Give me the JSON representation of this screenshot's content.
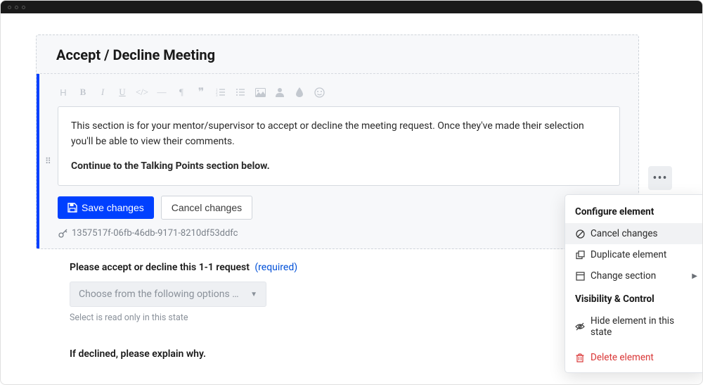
{
  "section": {
    "title": "Accept / Decline Meeting"
  },
  "editor": {
    "paragraph1": "This section is for your mentor/supervisor to accept or decline the meeting request. Once they've made their selection you'll be able to view their comments.",
    "paragraph2": "Continue to the Talking Points section below."
  },
  "buttons": {
    "save": "Save changes",
    "cancel": "Cancel changes"
  },
  "element_key": "1357517f-06fb-46db-9171-8210df53ddfc",
  "fields": {
    "accept_decline": {
      "label": "Please accept or decline this 1-1 request",
      "required_text": "(required)",
      "select_placeholder": "Choose from the following options …",
      "helper": "Select is read only in this state"
    },
    "explain": {
      "label": "If declined, please explain why."
    }
  },
  "popover": {
    "group1_title": "Configure element",
    "cancel_changes": "Cancel changes",
    "duplicate": "Duplicate element",
    "change_section": "Change section",
    "group2_title": "Visibility & Control",
    "hide": "Hide element in this state",
    "delete": "Delete element"
  },
  "toolbar_icons": [
    "heading",
    "bold",
    "italic",
    "underline",
    "code",
    "hr",
    "paragraph",
    "quote",
    "ol",
    "ul",
    "image",
    "user",
    "tint",
    "emoji"
  ]
}
